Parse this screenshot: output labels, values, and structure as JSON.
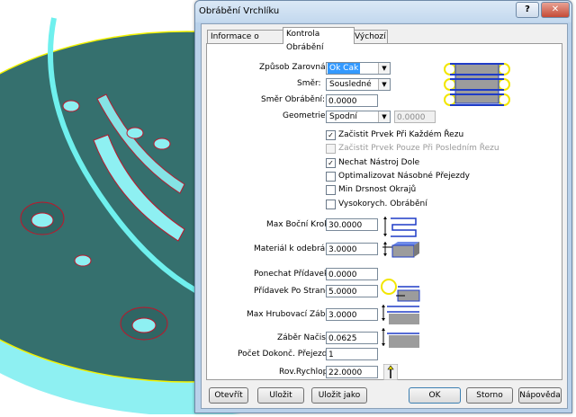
{
  "dialog": {
    "title": "Obrábění Vrchlíku",
    "help_glyph": "?",
    "close_glyph": "✕"
  },
  "tabs": [
    {
      "label": "Informace o Nástroji"
    },
    {
      "label": "Kontrola Obrábění"
    },
    {
      "label": "Výchozí"
    }
  ],
  "form": {
    "alignment_label": "Způsob Zarovnání:",
    "alignment_value": "Ok Cak",
    "direction_label": "Směr:",
    "direction_value": "Sousledné",
    "cut_direction_label": "Směr Obrábění:",
    "cut_direction_value": "0.0000",
    "geometry_label": "Geometrie je:",
    "geometry_value": "Spodní",
    "geometry_extra_value": "0.0000",
    "checkboxes": [
      {
        "label": "Začistit Prvek Při Každém Řezu",
        "checked": true,
        "enabled": true
      },
      {
        "label": "Začistit Prvek Pouze Při Posledním Řezu",
        "checked": false,
        "enabled": false
      },
      {
        "label": "Nechat Nástroj Dole",
        "checked": true,
        "enabled": true
      },
      {
        "label": "Optimalizovat Násobné Přejezdy",
        "checked": false,
        "enabled": true
      },
      {
        "label": "Min Drsnost Okrajů",
        "checked": false,
        "enabled": true
      },
      {
        "label": "Vysokorych. Obrábění",
        "checked": false,
        "enabled": true
      }
    ],
    "stepover_label": "Max Boční Krok:",
    "stepover_value": "30.0000",
    "stock_label": "Materiál k odebrání:",
    "stock_value": "3.0000",
    "leave_label": "Ponechat Přídavek:",
    "leave_value": "0.0000",
    "side_allowance_label": "Přídavek Po Straně:",
    "side_allowance_value": "5.0000",
    "max_stepdown_label": "Max Hrubovací Záběr:",
    "max_stepdown_value": "3.0000",
    "finish_stepdown_label": "Záběr Načisto:",
    "finish_stepdown_value": "0.0625",
    "finish_passes_label": "Počet Dokonč. Přejezdů:",
    "finish_passes_value": "1",
    "rapid_label": "Rov.Rychlop:",
    "rapid_value": "22.0000"
  },
  "buttons": {
    "open": "Otevřít",
    "save": "Uložit",
    "save_as": "Uložit jako",
    "ok": "OK",
    "cancel": "Storno",
    "help": "Nápověda"
  },
  "colors": {
    "part_face": "#35706e",
    "part_side": "#8ef0f2",
    "edge_highlight": "#f2f200",
    "hole_edge": "#c0152a",
    "dialog_frame": "#b9d1ea",
    "diagram_blue": "#1f3cc7",
    "diagram_gray": "#9c9c9c",
    "diagram_yellow": "#f2e600"
  }
}
